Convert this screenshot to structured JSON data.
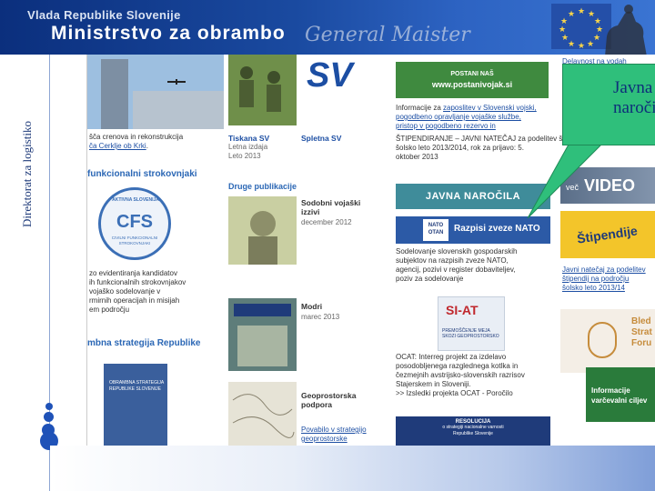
{
  "header": {
    "gov_name": "Vlada Republike Slovenije",
    "ministry": "Ministrstvo za obrambo",
    "signature": "General Maister"
  },
  "side_title": "Direktorat za logistiko",
  "col1": {
    "top_text": "šča crenova in rekonstrukcija",
    "top_link": "ča Cerklje ob Krki",
    "top_tail": ".",
    "head1": "funkcionalni strokovnjaki",
    "cfs_top": "AKTIVNA SLOVENIJA",
    "cfs_mid": "CFS",
    "cfs_sub": "CIVILNI FUNKCIONALNI STROKOVNJAKI",
    "para1": "zo evidentiranja kandidatov\nih funkcionalnih strokovnjakov\nvojaško sodelovanje v\nrmirnih operacijah in misijah\nem področju",
    "head2": "mbna strategija Republike\n",
    "book_title": "OBRAMBNA STRATEGIJA\nREPUBLIKE SLOVENIJE"
  },
  "col2": {
    "sv_logo": "SV",
    "tiskana": "Tiskana SV",
    "tiskana_sub": "Letna izdaja\nLeto 2013",
    "spletna": "Spletna SV",
    "druge": "Druge publikacije",
    "pub1_title": "Sodobni vojaški\nizzivi",
    "pub1_date": "december 2012",
    "pub2_title": "Modri",
    "pub2_date": "marec 2013",
    "pub3_title": "Geoprostorska\npodpora",
    "pub3_link": "Povabilo v strategijo\ngeoprostorske"
  },
  "col3": {
    "postani_top": "POSTANI NAŠ",
    "postani_url": "www.postanivojak.si",
    "info_text": "Informacije za ",
    "info_links": "zaposlitev v Slovenski vojski,\npogodbeno opravljanje vojaške službe,\npristop v pogodbeno rezervo in",
    "info_mid": "",
    "info_tail": "ŠTIPENDIRANJE – JAVNI NATEČAJ za podelitev štipendij za\nšolsko leto 2013/2014, rok za prijavo: 5.\noktober 2013",
    "javna": "JAVNA NAROČILA",
    "nato_label": "NATO\nOTAN",
    "nato_title": "Razpisi zveze NATO",
    "nato_text": "Sodelovanje slovenskih gospodarskih\nsubjektov na razpisih zveze NATO,\nagencij, pozivi v register dobaviteljev,\npoziv za sodelovanje",
    "project_logo": "SI-AT",
    "project_sub": "PREMOŠČENJE MEJA\nSKOZI GEOPROSTORSKO",
    "ocat": "OCAT: Interreg projekt za izdelavo\nposodobljenega razglednega kotlka in\nčezmejnih avstrijsko-slovenskih razrisov\nStajerskem in Sloveniji.\n>> Izsledki projekta OCAT - Poročilo",
    "resol_title": "RESOLUCIJA",
    "resol_sub": "o strategiji nacionalne varnosti\nRepublike Slovenije"
  },
  "col4": {
    "top_link": "Delavnost na vodah",
    "vec": "več",
    "video": "VIDEO",
    "stip": "Štipendije",
    "stip_text": "Javni natečaj za podelitev\nštipendij na področju\nšolsko leto 2013/14",
    "blue_text": "Informacije\nvarčevalni ciljev",
    "bled": "Bled\nStrat\nForu"
  },
  "callout": {
    "text": "Javna naročila"
  },
  "colors": {
    "header_dark": "#0b2f7d",
    "accent_blue": "#1c4ea3",
    "callout_green": "#2fbf7b",
    "javna_teal": "#3f8c9a",
    "nato_blue": "#2c5aa6",
    "resol_navy": "#1f3b7a"
  }
}
